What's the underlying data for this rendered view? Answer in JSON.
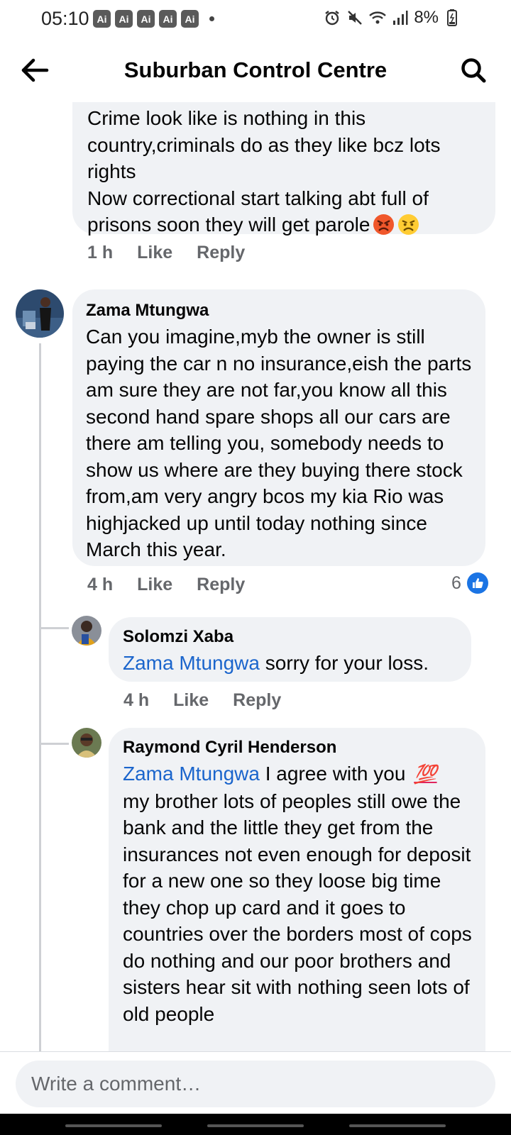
{
  "status_bar": {
    "time": "05:10",
    "ai_badges": [
      "Ai",
      "Ai",
      "Ai",
      "Ai",
      "Ai"
    ],
    "battery": "8%",
    "icons": [
      "alarm-icon",
      "mute-icon",
      "wifi-icon",
      "signal-icon",
      "battery-icon"
    ]
  },
  "header": {
    "title": "Suburban Control Centre",
    "back_icon": "arrow-left-icon",
    "search_icon": "search-icon"
  },
  "comments": [
    {
      "text": "Crime look like is nothing in this country,criminals do as they like bcz lots rights\nNow correctional start talking abt full of prisons soon they will get parole",
      "emojis": [
        "angry-face-icon",
        "frowning-face-icon"
      ],
      "time": "1 h",
      "like_label": "Like",
      "reply_label": "Reply"
    },
    {
      "author": "Zama Mtungwa",
      "text": "Can you imagine,myb the owner is still paying the car n no insurance,eish the parts am sure they are not far,you know all this second hand spare shops all our cars are there am telling you, somebody needs to show us where are they buying there stock from,am very angry bcos my kia Rio was highjacked up until today nothing since March this year.",
      "time": "4 h",
      "like_label": "Like",
      "reply_label": "Reply",
      "reaction_count": "6"
    },
    {
      "author": "Solomzi Xaba",
      "mention": "Zama Mtungwa",
      "text": " sorry for your loss.",
      "time": "4 h",
      "like_label": "Like",
      "reply_label": "Reply"
    },
    {
      "author": "Raymond Cyril Henderson",
      "mention": "Zama Mtungwa",
      "text_before_emoji": " I agree with you ",
      "emoji": "💯",
      "text": "my brother lots of peoples still owe the bank and the little they get from the insurances not even enough for deposit for a new one so they loose big time they chop up card and it goes to countries over the borders most of cops do nothing and our poor brothers and sisters hear sit with nothing seen lots of old people"
    }
  ],
  "composer": {
    "placeholder": "Write a comment…"
  },
  "colors": {
    "bubble": "#f0f2f5",
    "mention": "#1b65cc",
    "muted": "#65676b",
    "like_blue": "#1b74e4"
  }
}
